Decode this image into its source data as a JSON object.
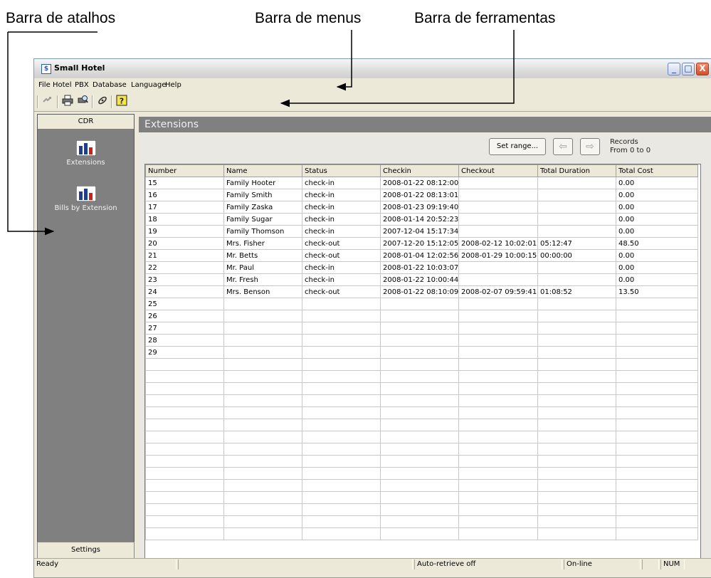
{
  "annotations": {
    "shortcut_bar": "Barra de atalhos",
    "menu_bar": "Barra de menus",
    "tool_bar": "Barra de ferramentas"
  },
  "window": {
    "title": "Small Hotel",
    "controls": {
      "minimize": "_",
      "maximize": "□",
      "close": "X"
    }
  },
  "menu": [
    "File",
    "Hotel",
    "PBX",
    "Database",
    "Language",
    "Help"
  ],
  "toolbar": {
    "icons": [
      "connect-icon",
      "print-icon",
      "print-preview-icon",
      "refresh-icon",
      "help-icon"
    ]
  },
  "sidebar": {
    "header": "CDR",
    "items": [
      {
        "label": "Extensions",
        "icon": "bar-chart-icon"
      },
      {
        "label": "Bills by Extension",
        "icon": "bar-chart-icon"
      }
    ],
    "footer": "Settings"
  },
  "content": {
    "title": "Extensions",
    "set_range_label": "Set range...",
    "prev_icon": "arrow-left-icon",
    "next_icon": "arrow-right-icon",
    "records_label": "Records",
    "records_range": "From 0 to 0"
  },
  "table": {
    "columns": [
      "Number",
      "Name",
      "Status",
      "Checkin",
      "Checkout",
      "Total Duration",
      "Total Cost"
    ],
    "rows": [
      [
        "15",
        "Family Hooter",
        "check-in",
        "2008-01-22 08:12:00",
        "",
        "",
        "0.00"
      ],
      [
        "16",
        "Family Smith",
        "check-in",
        "2008-01-22 08:13:01",
        "",
        "",
        "0.00"
      ],
      [
        "17",
        "Family Zaska",
        "check-in",
        "2008-01-23 09:19:40",
        "",
        "",
        "0.00"
      ],
      [
        "18",
        "Family Sugar",
        "check-in",
        "2008-01-14 20:52:23",
        "",
        "",
        "0.00"
      ],
      [
        "19",
        "Family Thomson",
        "check-in",
        "2007-12-04 15:17:34",
        "",
        "",
        "0.00"
      ],
      [
        "20",
        "Mrs. Fisher",
        "check-out",
        "2007-12-20 15:12:05",
        "2008-02-12 10:02:01",
        "05:12:47",
        "48.50"
      ],
      [
        "21",
        "Mr. Betts",
        "check-out",
        "2008-01-04 12:02:56",
        "2008-01-29 10:00:15",
        "00:00:00",
        "0.00"
      ],
      [
        "22",
        "Mr. Paul",
        "check-in",
        "2008-01-22 10:03:07",
        "",
        "",
        "0.00"
      ],
      [
        "23",
        "Mr. Fresh",
        "check-in",
        "2008-01-22 10:00:44",
        "",
        "",
        "0.00"
      ],
      [
        "24",
        "Mrs. Benson",
        "check-out",
        "2008-01-22 08:10:09",
        "2008-02-07 09:59:41",
        "01:08:52",
        "13.50"
      ],
      [
        "25",
        "",
        "",
        "",
        "",
        "",
        ""
      ],
      [
        "26",
        "",
        "",
        "",
        "",
        "",
        ""
      ],
      [
        "27",
        "",
        "",
        "",
        "",
        "",
        ""
      ],
      [
        "28",
        "",
        "",
        "",
        "",
        "",
        ""
      ],
      [
        "29",
        "",
        "",
        "",
        "",
        "",
        ""
      ]
    ]
  },
  "statusbar": {
    "ready": "Ready",
    "empty1": "",
    "auto_retrieve": "Auto-retrieve off",
    "online": "On-line",
    "num": "NUM"
  }
}
